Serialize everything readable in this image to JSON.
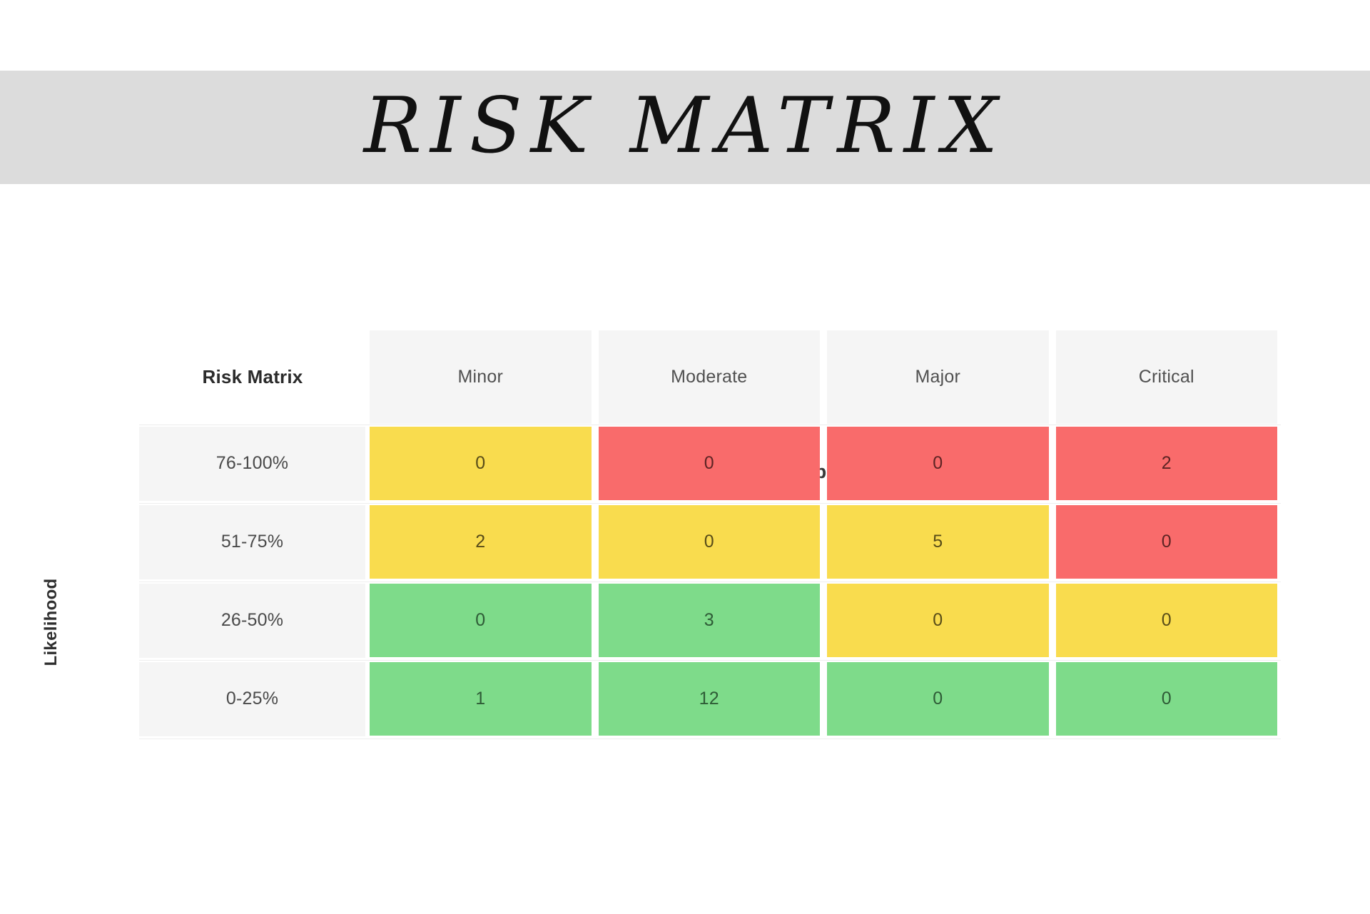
{
  "page": {
    "title": "RISK MATRIX",
    "background": "#ffffff",
    "band_color": "#dcdcdc"
  },
  "axes": {
    "column_axis_label": "Impact",
    "row_axis_label": "Likelihood"
  },
  "colors": {
    "low": "#7edb8a",
    "medium": "#f9dc4e",
    "high": "#f96b6b",
    "header_cell": "#f5f5f5",
    "band": "#dcdcdc"
  },
  "chart_data": {
    "type": "heatmap",
    "title": "RISK MATRIX",
    "corner_label": "Risk Matrix",
    "xlabel": "Impact",
    "ylabel": "Likelihood",
    "categories": [
      "Minor",
      "Moderate",
      "Major",
      "Critical"
    ],
    "rows": [
      "76-100%",
      "51-75%",
      "26-50%",
      "0-25%"
    ],
    "values": [
      [
        0,
        0,
        0,
        2
      ],
      [
        2,
        0,
        5,
        0
      ],
      [
        0,
        3,
        0,
        0
      ],
      [
        1,
        12,
        0,
        0
      ]
    ],
    "levels": [
      [
        "medium",
        "high",
        "high",
        "high"
      ],
      [
        "medium",
        "medium",
        "medium",
        "high"
      ],
      [
        "low",
        "low",
        "medium",
        "medium"
      ],
      [
        "low",
        "low",
        "low",
        "low"
      ]
    ],
    "level_colors": {
      "low": "#7edb8a",
      "medium": "#f9dc4e",
      "high": "#f96b6b"
    },
    "grid": true,
    "legend": "none"
  }
}
